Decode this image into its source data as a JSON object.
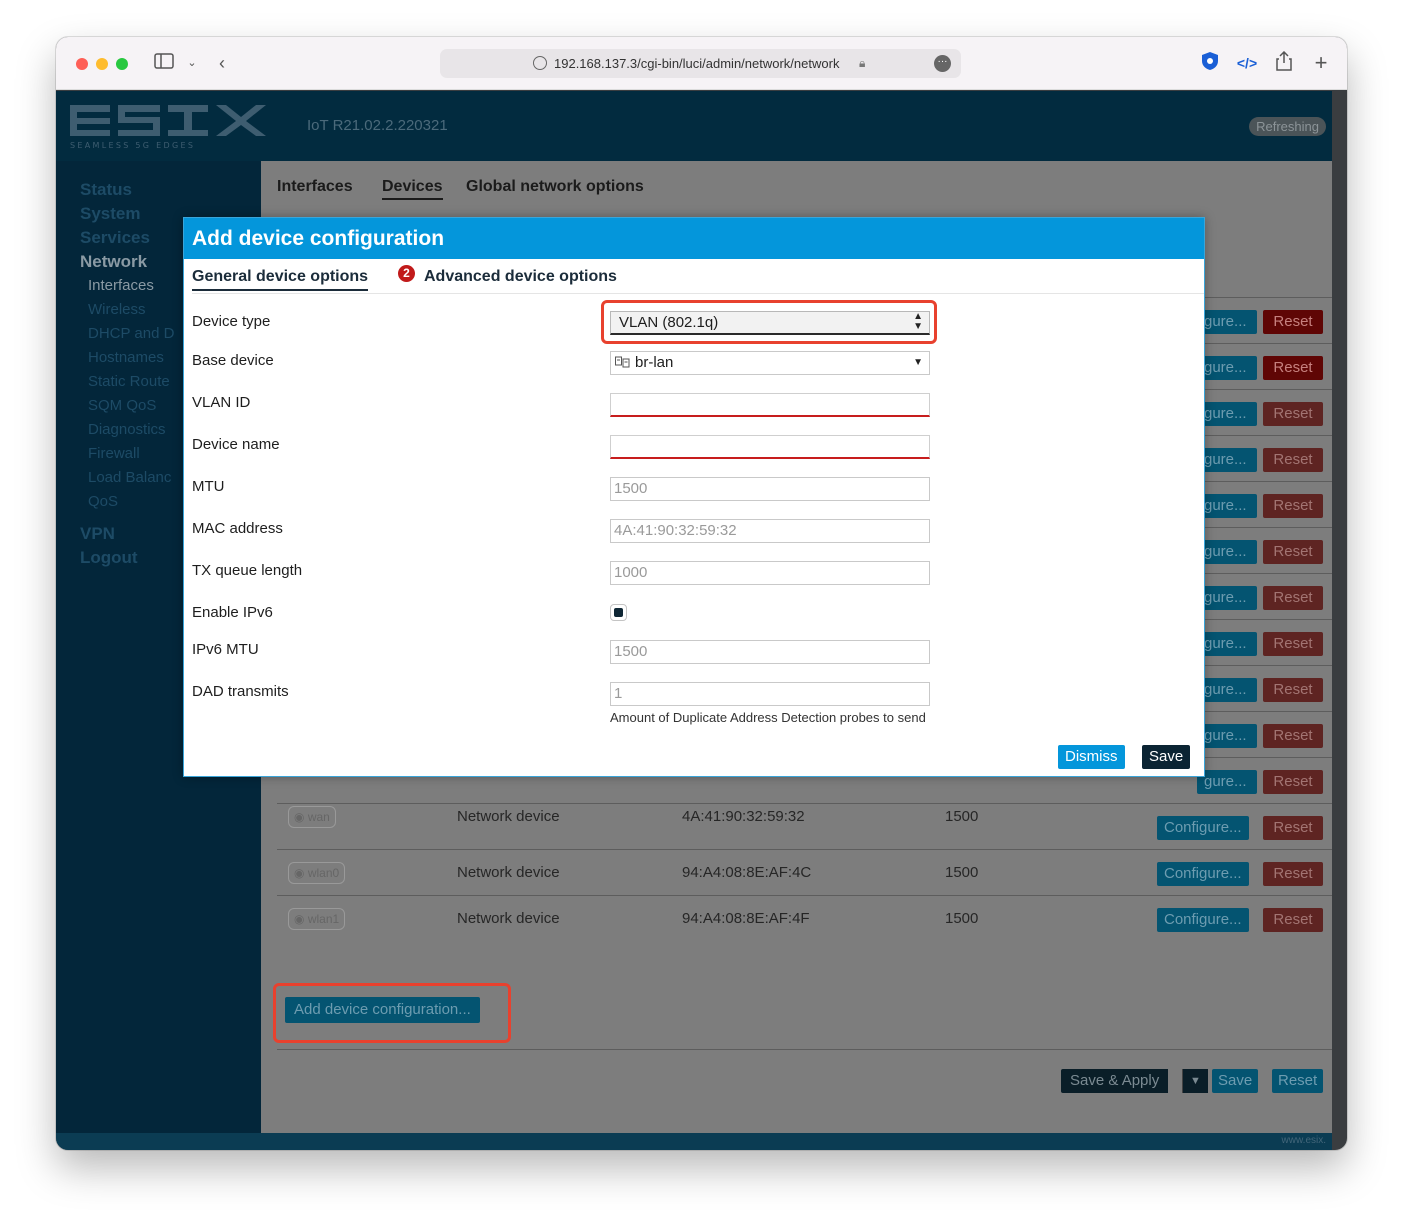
{
  "browser": {
    "url": "192.168.137.3/cgi-bin/luci/admin/network/network"
  },
  "header": {
    "version": "IoT R21.02.2.220321",
    "status_badge": "Refreshing"
  },
  "sidebar": {
    "items": [
      "Status",
      "System",
      "Services",
      "Network"
    ],
    "network_sub": [
      "Interfaces",
      "Wireless",
      "DHCP and D",
      "Hostnames",
      "Static Route",
      "SQM QoS",
      "Diagnostics",
      "Firewall",
      "Load Balanc",
      "QoS"
    ],
    "bottom_items": [
      "VPN",
      "Logout"
    ]
  },
  "content": {
    "tabs": [
      "Interfaces",
      "Devices",
      "Global network options"
    ],
    "configure_label": "Configure...",
    "configure_partial": "gure...",
    "reset_label": "Reset",
    "rows": [
      {
        "name": "wan",
        "type": "Network device",
        "mac": "4A:41:90:32:59:32",
        "mtu": "1500"
      },
      {
        "name": "wlan0",
        "type": "Network device",
        "mac": "94:A4:08:8E:AF:4C",
        "mtu": "1500"
      },
      {
        "name": "wlan1",
        "type": "Network device",
        "mac": "94:A4:08:8E:AF:4F",
        "mtu": "1500"
      }
    ],
    "add_device_label": "Add device configuration...",
    "save_apply_label": "Save & Apply",
    "save_label": "Save",
    "reset_all_label": "Reset"
  },
  "footer": {
    "text": "www.esix."
  },
  "modal": {
    "title": "Add device configuration",
    "tabs": [
      "General device options",
      "Advanced device options"
    ],
    "error_count": "2",
    "fields": {
      "device_type": {
        "label": "Device type",
        "value": "VLAN (802.1q)"
      },
      "base_device": {
        "label": "Base device",
        "value": "br-lan"
      },
      "vlan_id": {
        "label": "VLAN ID",
        "value": ""
      },
      "device_name": {
        "label": "Device name",
        "value": ""
      },
      "mtu": {
        "label": "MTU",
        "placeholder": "1500"
      },
      "mac": {
        "label": "MAC address",
        "placeholder": "4A:41:90:32:59:32"
      },
      "txqueuelen": {
        "label": "TX queue length",
        "placeholder": "1000"
      },
      "ipv6": {
        "label": "Enable IPv6",
        "checked": true
      },
      "ipv6_mtu": {
        "label": "IPv6 MTU",
        "placeholder": "1500"
      },
      "dad": {
        "label": "DAD transmits",
        "placeholder": "1",
        "hint": "Amount of Duplicate Address Detection probes to send"
      }
    },
    "dismiss_label": "Dismiss",
    "save_label": "Save"
  },
  "colors": {
    "header_bg": "#022b3f",
    "modal_accent": "#0496db",
    "highlight": "#e8412e",
    "error": "#c11a1a"
  }
}
